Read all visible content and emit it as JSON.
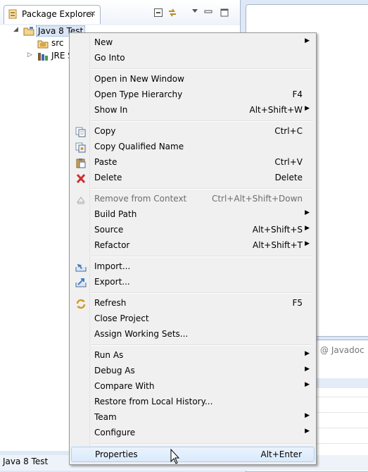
{
  "package_explorer": {
    "tab_title": "Package Explorer",
    "tree": [
      {
        "label": "Java 8 Test",
        "icon": "java-project-icon",
        "expanded": true,
        "selected": true
      },
      {
        "label": "src",
        "icon": "source-folder-icon"
      },
      {
        "label": "JRE S",
        "icon": "jre-library-icon",
        "expanded": false
      }
    ]
  },
  "bottom_panel": {
    "javadoc_tab": "@ Javadoc"
  },
  "status_bar": {
    "text": "Java 8 Test"
  },
  "context_menu": {
    "items": [
      {
        "label": "New",
        "shortcut": "",
        "submenu": true
      },
      {
        "label": "Go Into",
        "shortcut": ""
      },
      {
        "label": "Open in New Window",
        "shortcut": ""
      },
      {
        "label": "Open Type Hierarchy",
        "shortcut": "F4"
      },
      {
        "label": "Show In",
        "shortcut": "Alt+Shift+W",
        "submenu": true
      },
      {
        "label": "Copy",
        "shortcut": "Ctrl+C",
        "icon": "copy-icon"
      },
      {
        "label": "Copy Qualified Name",
        "shortcut": "",
        "icon": "copy-qualified-name-icon"
      },
      {
        "label": "Paste",
        "shortcut": "Ctrl+V",
        "icon": "paste-icon"
      },
      {
        "label": "Delete",
        "shortcut": "Delete",
        "icon": "delete-icon"
      },
      {
        "label": "Remove from Context",
        "shortcut": "Ctrl+Alt+Shift+Down",
        "icon": "remove-from-context-icon",
        "disabled": true
      },
      {
        "label": "Build Path",
        "shortcut": "",
        "submenu": true
      },
      {
        "label": "Source",
        "shortcut": "Alt+Shift+S",
        "submenu": true
      },
      {
        "label": "Refactor",
        "shortcut": "Alt+Shift+T",
        "submenu": true
      },
      {
        "label": "Import...",
        "shortcut": "",
        "icon": "import-icon"
      },
      {
        "label": "Export...",
        "shortcut": "",
        "icon": "export-icon"
      },
      {
        "label": "Refresh",
        "shortcut": "F5",
        "icon": "refresh-icon"
      },
      {
        "label": "Close Project",
        "shortcut": ""
      },
      {
        "label": "Assign Working Sets...",
        "shortcut": ""
      },
      {
        "label": "Run As",
        "shortcut": "",
        "submenu": true
      },
      {
        "label": "Debug As",
        "shortcut": "",
        "submenu": true
      },
      {
        "label": "Compare With",
        "shortcut": "",
        "submenu": true
      },
      {
        "label": "Restore from Local History...",
        "shortcut": ""
      },
      {
        "label": "Team",
        "shortcut": "",
        "submenu": true
      },
      {
        "label": "Configure",
        "shortcut": "",
        "submenu": true
      },
      {
        "label": "Properties",
        "shortcut": "Alt+Enter",
        "hovered": true
      }
    ]
  },
  "colors": {
    "menu_background": "#f0f0f0",
    "hover_highlight": "#d9eafc",
    "window_frame": "#dfe8f6"
  }
}
